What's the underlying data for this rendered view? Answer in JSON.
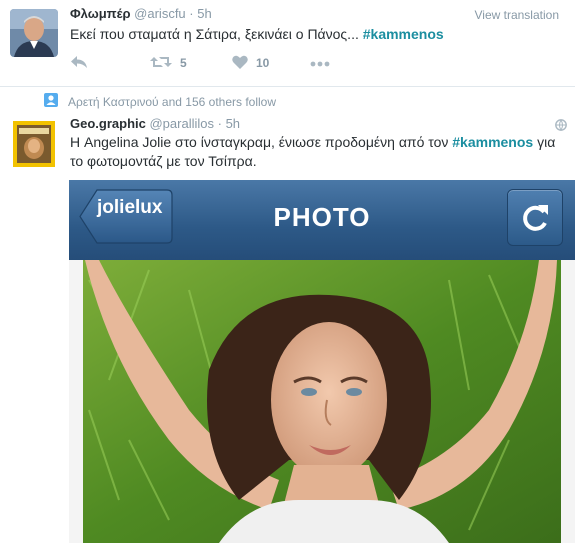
{
  "tweet1": {
    "name": "Φλωμπέρ",
    "handle": "@ariscfu",
    "separator": "·",
    "time": "5h",
    "text_before": "Εκεί που σταματά η Σάτιρα, ξεκινάει ο Πάνος... ",
    "hashtag": "#kammenos",
    "view_translation": "View translation",
    "retweet_count": "5",
    "like_count": "10"
  },
  "context": {
    "text": "Αρετή Καστρινού and 156 others follow"
  },
  "tweet2": {
    "name": "Geo.graphic",
    "handle": "@parallilos",
    "separator": "·",
    "time": "5h",
    "text_line1_before": "Η Angelina Jolie στο ίνσταγκραμ, ένιωσε προδομένη από τον ",
    "hashtag": "#kammenos",
    "text_line1_after": " για",
    "text_line2": "το φωτομοντάζ με τον Τσίπρα."
  },
  "media": {
    "back_label": "jolielux",
    "title": "PHOTO"
  },
  "colors": {
    "hashtag": "#1b8ea0",
    "muted": "#8899a6",
    "app_bar": "#2d5987"
  },
  "icons": [
    "reply-icon",
    "retweet-icon",
    "like-icon",
    "more-icon",
    "user-follow-icon",
    "refresh-icon",
    "globe-icon"
  ]
}
